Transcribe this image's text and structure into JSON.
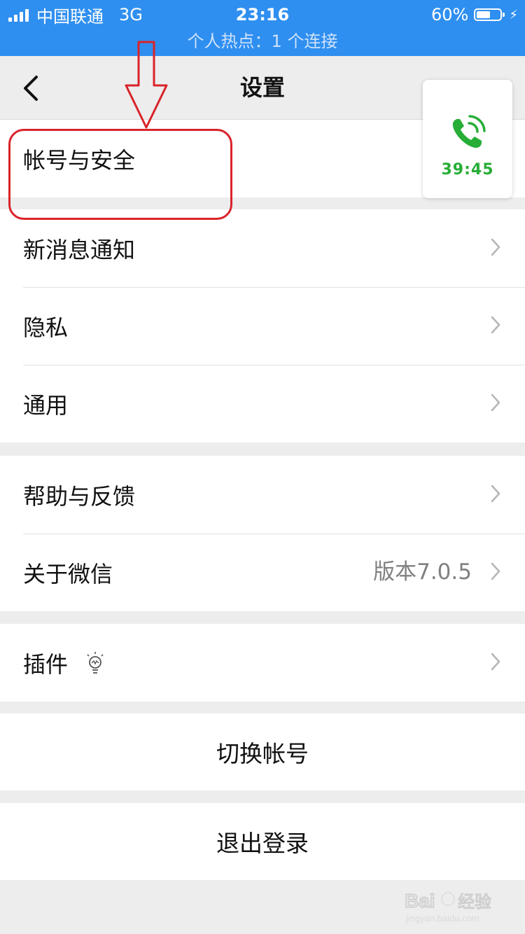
{
  "status_bar": {
    "carrier": "中国联通",
    "network": "3G",
    "time": "23:16",
    "battery_percent": "60%",
    "battery_level": 0.6,
    "hotspot": "个人热点：1 个连接"
  },
  "nav": {
    "title": "设置"
  },
  "call_widget": {
    "duration": "39:45",
    "accent_color": "#27ae36"
  },
  "groups": {
    "account": {
      "label": "帐号与安全"
    },
    "notifications": {
      "label": "新消息通知"
    },
    "privacy": {
      "label": "隐私"
    },
    "general": {
      "label": "通用"
    },
    "help": {
      "label": "帮助与反馈"
    },
    "about": {
      "label": "关于微信",
      "value": "版本7.0.5"
    },
    "plugins": {
      "label": "插件"
    }
  },
  "actions": {
    "switch_account": "切换帐号",
    "logout": "退出登录"
  },
  "watermark": {
    "brand": "Bai经验",
    "url": "jingyan.baidu.com"
  },
  "colors": {
    "status_bar_bg": "#2f8ff0",
    "annotation_red": "#d9242b",
    "page_bg": "#ededed"
  }
}
